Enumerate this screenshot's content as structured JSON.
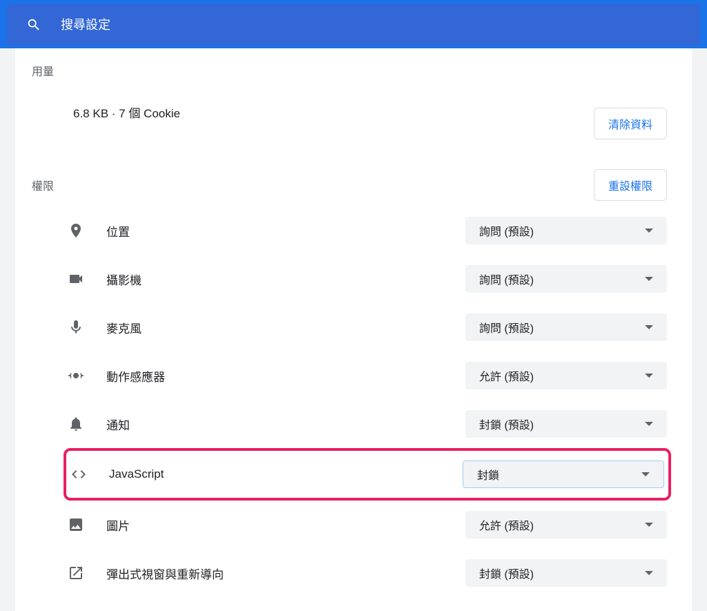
{
  "search": {
    "placeholder": "搜尋設定"
  },
  "usage": {
    "title": "用量",
    "text": "6.8 KB · 7 個 Cookie",
    "clear_button": "清除資料"
  },
  "permissions": {
    "title": "權限",
    "reset_button": "重設權限",
    "items": [
      {
        "label": "位置",
        "value": "詢問 (預設)"
      },
      {
        "label": "攝影機",
        "value": "詢問 (預設)"
      },
      {
        "label": "麥克風",
        "value": "詢問 (預設)"
      },
      {
        "label": "動作感應器",
        "value": "允許 (預設)"
      },
      {
        "label": "通知",
        "value": "封鎖 (預設)"
      },
      {
        "label": "JavaScript",
        "value": "封鎖"
      },
      {
        "label": "圖片",
        "value": "允許 (預設)"
      },
      {
        "label": "彈出式視窗與重新導向",
        "value": "封鎖 (預設)"
      }
    ]
  }
}
